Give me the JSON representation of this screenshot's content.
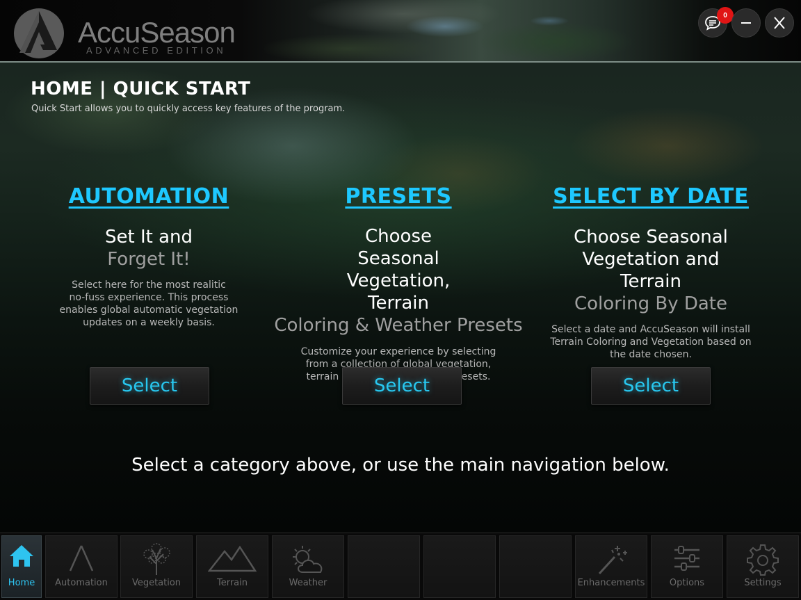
{
  "header": {
    "logo_name": "AccuSeason",
    "logo_sub": "ADVANCED EDITION",
    "notification_count": "0"
  },
  "page": {
    "title": "HOME | QUICK START",
    "subtitle": "Quick Start allows you to quickly access key features of the program."
  },
  "columns": [
    {
      "title": "AUTOMATION",
      "head_bright": "Set It and",
      "head_dim": "Forget It!",
      "desc_lines": [
        "Select here for the most realitic",
        "no-fuss experience. This process",
        "enables global automatic vegetation",
        "updates on a weekly basis."
      ],
      "button": "Select"
    },
    {
      "title": "PRESETS",
      "head_bright": "Choose Seasonal Vegetation, Terrain",
      "head_dim": "Coloring & Weather Presets",
      "desc_lines": [
        "Customize your experience by selecting",
        "from a collection of global vegetation,",
        "terrain coloring, and weather presets."
      ],
      "button": "Select"
    },
    {
      "title": "SELECT BY DATE",
      "head_bright": "Choose Seasonal Vegetation and Terrain",
      "head_dim": "Coloring By Date",
      "desc_lines": [
        "Select a date and AccuSeason will install",
        "Terrain Coloring and Vegetation based on",
        "the date chosen."
      ],
      "button": "Select"
    }
  ],
  "hint": "Select a category above, or use the main navigation below.",
  "nav": [
    {
      "label": "Home",
      "icon": "home-icon",
      "active": true
    },
    {
      "label": "Automation",
      "icon": "automation-icon"
    },
    {
      "label": "Vegetation",
      "icon": "tree-icon"
    },
    {
      "label": "Terrain",
      "icon": "mountain-icon"
    },
    {
      "label": "Weather",
      "icon": "weather-icon"
    },
    {
      "label": "",
      "icon": ""
    },
    {
      "label": "",
      "icon": ""
    },
    {
      "label": "",
      "icon": ""
    },
    {
      "label": "Enhancements",
      "icon": "magic-wand-icon"
    },
    {
      "label": "Options",
      "icon": "sliders-icon"
    },
    {
      "label": "Settings",
      "icon": "gear-icon"
    }
  ],
  "colors": {
    "accent": "#1ec8ff",
    "badge": "#e01515"
  }
}
